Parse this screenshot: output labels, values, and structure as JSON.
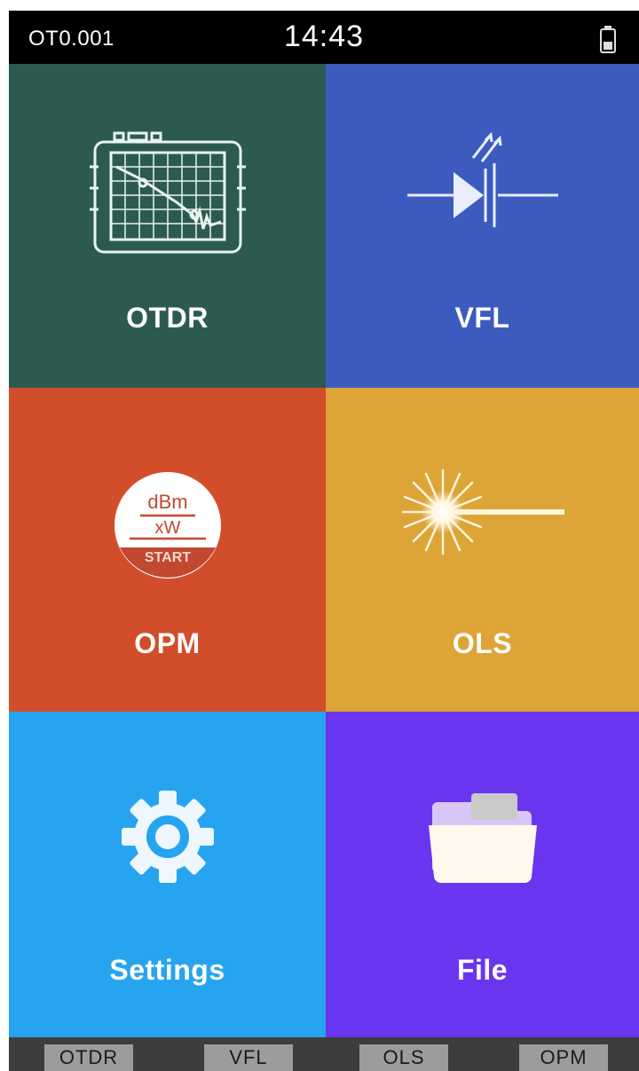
{
  "status_bar": {
    "device_id": "OT0.001",
    "time": "14:43",
    "battery_icon": "battery-icon"
  },
  "tiles": [
    {
      "label": "OTDR",
      "icon": "otdr-device-icon",
      "color": "#2d5a50"
    },
    {
      "label": "VFL",
      "icon": "laser-diode-icon",
      "color": "#3d5bbf"
    },
    {
      "label": "OPM",
      "icon": "power-meter-icon",
      "color": "#d24d2a",
      "icon_text": {
        "top": "dBm",
        "middle": "xW",
        "bottom": "START"
      }
    },
    {
      "label": "OLS",
      "icon": "light-source-icon",
      "color": "#dda437"
    },
    {
      "label": "Settings",
      "icon": "gear-icon",
      "color": "#27a4ef"
    },
    {
      "label": "File",
      "icon": "folder-icon",
      "color": "#6a35ef"
    }
  ],
  "bottom_bar": {
    "tabs": [
      "OTDR",
      "VFL",
      "OLS",
      "OPM"
    ]
  }
}
